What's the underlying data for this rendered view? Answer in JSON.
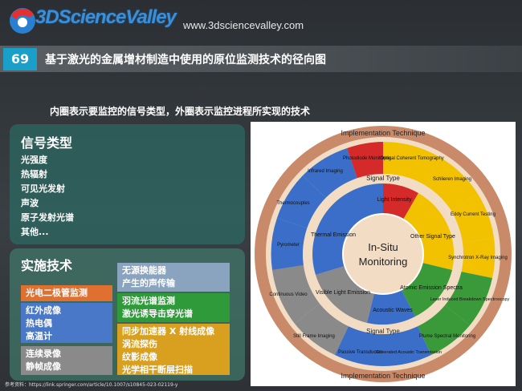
{
  "header": {
    "logo": "3DScienceValley",
    "url": "www.3dsciencevalley.com",
    "number": "69",
    "title": "基于激光的金属增材制造中使用的原位监测技术的径向图"
  },
  "subtitle": "内圈表示要监控的信号类型，外圈表示监控进程所实现的技术",
  "signal_panel": {
    "heading": "信号类型",
    "items": [
      "光强度",
      "热辐射",
      "可见光发射",
      "声波",
      "原子发射光谱",
      "其他..."
    ]
  },
  "tech_panel": {
    "heading": "实施技术",
    "boxes": [
      {
        "lines": [
          "无源换能器",
          "产生的声传输"
        ],
        "color": "#8aa4c0"
      },
      {
        "lines": [
          "光电二极管监测"
        ],
        "color": "#e07030"
      },
      {
        "lines": [
          "羽流光谱监测",
          "激光诱导击穿光谱"
        ],
        "color": "#2f9a3a"
      },
      {
        "lines": [
          "红外成像",
          "热电偶",
          "高温计"
        ],
        "color": "#4a78c8"
      },
      {
        "lines": [
          "同步加速器 X 射线成像",
          "涡流探伤",
          "纹影成像",
          "光学相干断层扫描"
        ],
        "color": "#d9a020"
      },
      {
        "lines": [
          "连续录像",
          "静帧成像"
        ],
        "color": "#8a8a8a"
      }
    ]
  },
  "diagram": {
    "center": "In-Situ\nMonitoring",
    "outer_ring_label": "Implementation Technique",
    "inner_ring_label": "Signal Type",
    "signals": [
      "Light Intensity",
      "Other Signal Type",
      "Atomic Emission Spectra",
      "Acoustic Waves",
      "Visible Light Emission",
      "Thermal Emission"
    ],
    "techniques": [
      "Photodiode Monitoring",
      "Optical Coherent Tomography",
      "Schlieren Imaging",
      "Eddy Current Testing",
      "Synchrotron X-Ray Imaging",
      "Laser Induced Breakdown Spectroscopy",
      "Plume Spectral Monitoring",
      "Generated Acoustic Transmission",
      "Passive Transducers",
      "Still Frame Imaging",
      "Continuous Video",
      "Pyrometer",
      "Thermocouples",
      "Infrared Imaging"
    ],
    "colors": {
      "red": "#d42a2a",
      "yellow": "#f2c200",
      "green": "#3a9a3a",
      "blue": "#3a6ec8",
      "gray": "#8a8a8a",
      "ring": "#e8c79c",
      "outer": "#c98a6a"
    }
  },
  "footer": "参考资料：https://link.springer.com/article/10.1007/s10845-023-02119-y"
}
